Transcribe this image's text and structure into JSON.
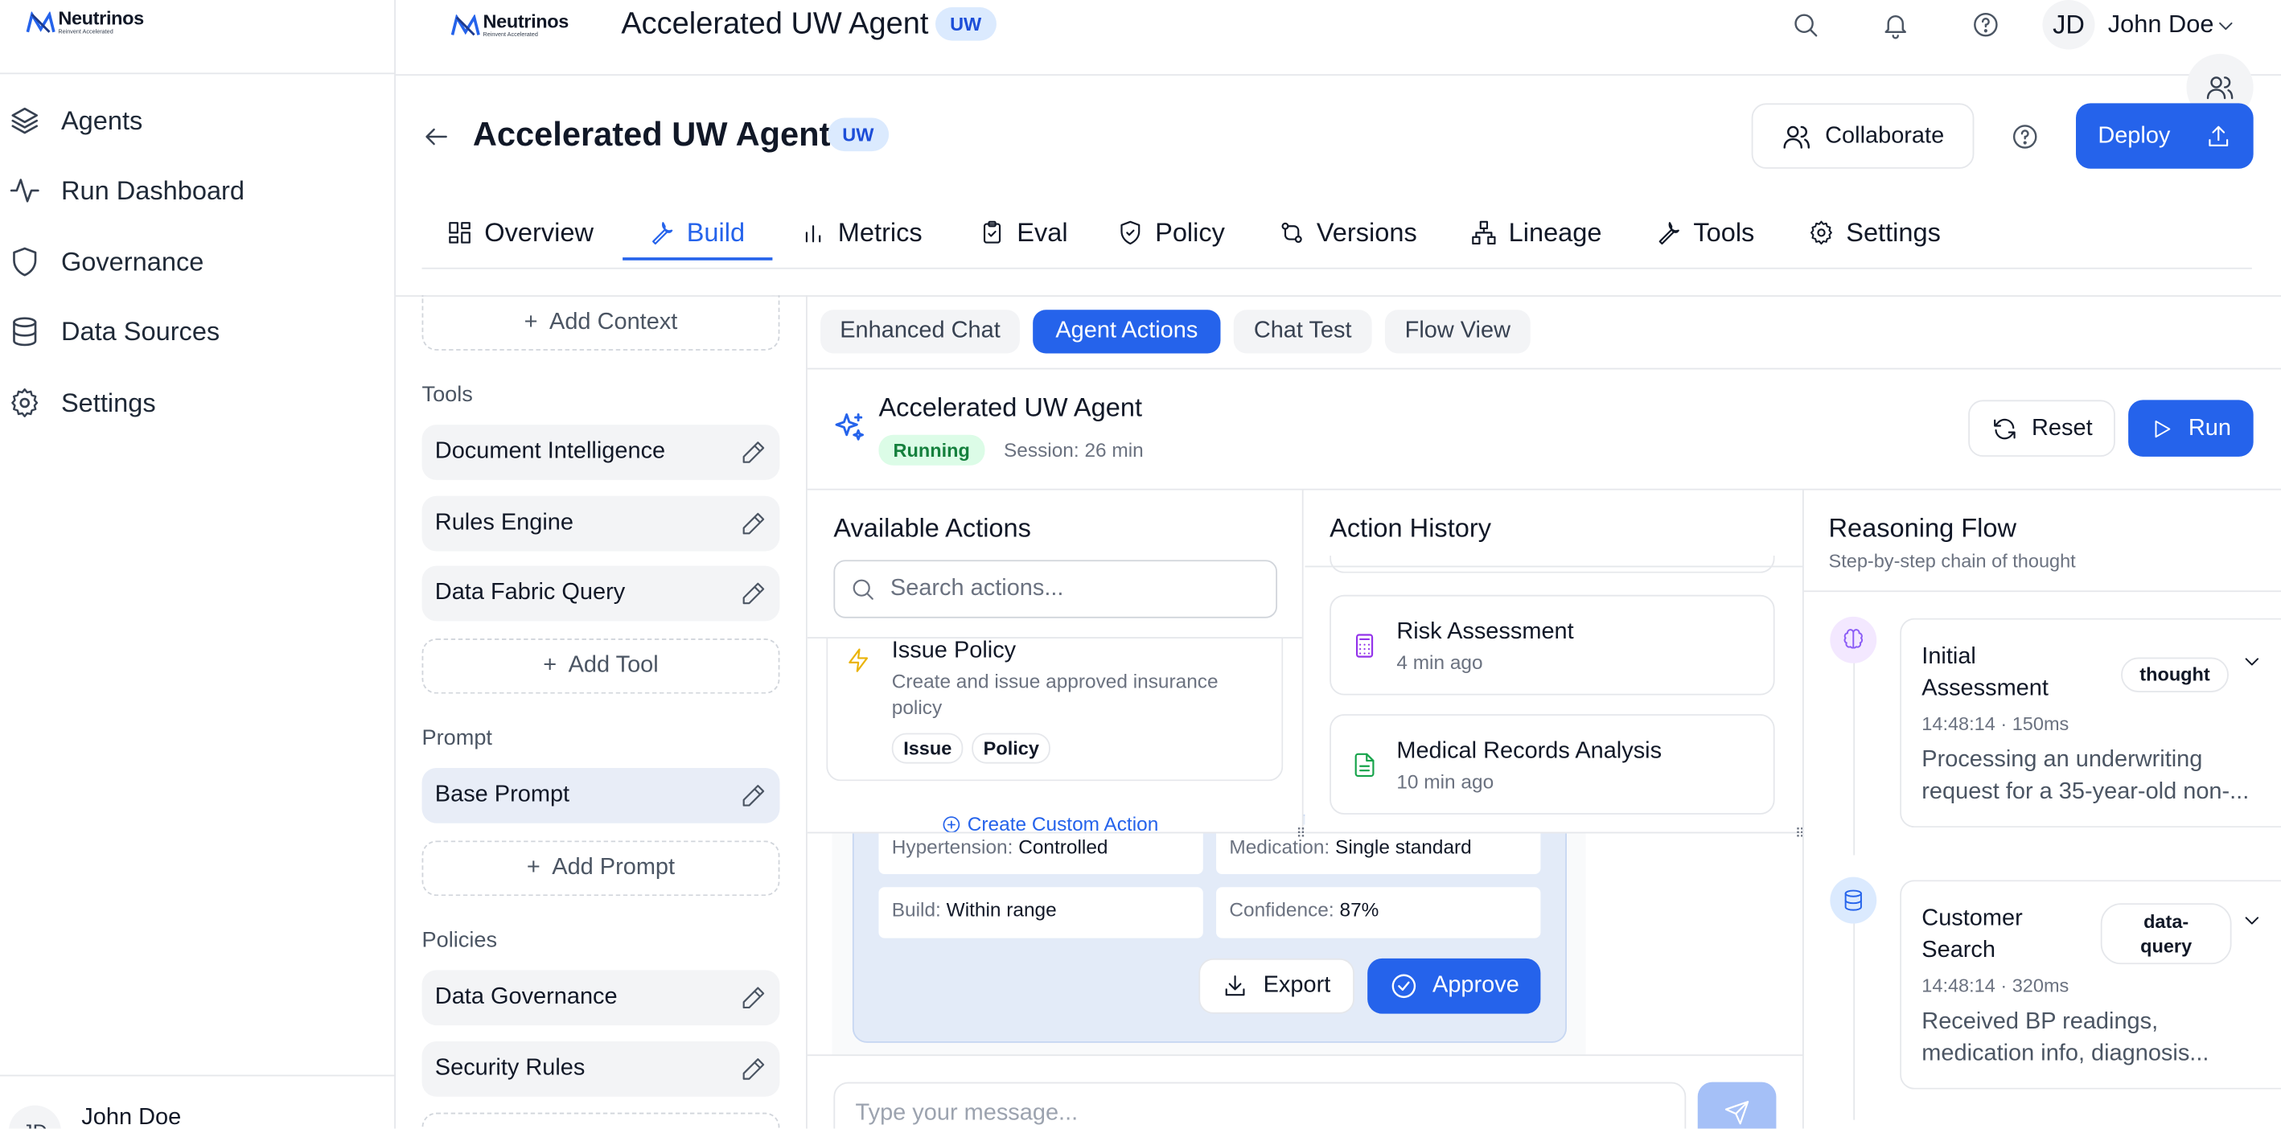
{
  "brand": {
    "name": "Neutrinos",
    "tagline": "Reinvent Accelerated"
  },
  "sidebar": {
    "items": [
      {
        "label": "Agents",
        "icon": "layers-icon"
      },
      {
        "label": "Run Dashboard",
        "icon": "activity-icon"
      },
      {
        "label": "Governance",
        "icon": "shield-icon"
      },
      {
        "label": "Data Sources",
        "icon": "database-icon"
      },
      {
        "label": "Settings",
        "icon": "gear-icon"
      }
    ],
    "user": {
      "initials": "JD",
      "name": "John Doe"
    }
  },
  "header": {
    "title": "Accelerated UW Agent",
    "badge": "UW",
    "user_initials": "JD",
    "user_name": "John Doe"
  },
  "agent": {
    "title": "Accelerated UW Agent",
    "badge": "UW",
    "collaborate_label": "Collaborate",
    "deploy_label": "Deploy"
  },
  "tabs": [
    {
      "label": "Overview",
      "icon": "grid-icon"
    },
    {
      "label": "Build",
      "icon": "wrench-icon",
      "active": true
    },
    {
      "label": "Metrics",
      "icon": "bar-chart-icon"
    },
    {
      "label": "Eval",
      "icon": "clipboard-check-icon"
    },
    {
      "label": "Policy",
      "icon": "shield-check-icon"
    },
    {
      "label": "Versions",
      "icon": "git-compare-icon"
    },
    {
      "label": "Lineage",
      "icon": "network-icon"
    },
    {
      "label": "Tools",
      "icon": "wrench-icon"
    },
    {
      "label": "Settings",
      "icon": "gear-icon"
    }
  ],
  "config": {
    "add_context": "Add Context",
    "tools_heading": "Tools",
    "tools": [
      "Document Intelligence",
      "Rules Engine",
      "Data Fabric Query"
    ],
    "add_tool": "Add Tool",
    "prompt_heading": "Prompt",
    "prompts": [
      "Base Prompt"
    ],
    "add_prompt": "Add Prompt",
    "policies_heading": "Policies",
    "policies": [
      "Data Governance",
      "Security Rules"
    ]
  },
  "subtabs": [
    "Enhanced Chat",
    "Agent Actions",
    "Chat Test",
    "Flow View"
  ],
  "active_subtab": "Agent Actions",
  "session": {
    "agent_name": "Accelerated UW Agent",
    "status": "Running",
    "session_label": "Session: 26 min",
    "reset_label": "Reset",
    "run_label": "Run"
  },
  "available_actions": {
    "heading": "Available Actions",
    "search_placeholder": "Search actions...",
    "action": {
      "title": "Issue Policy",
      "description": "Create and issue approved insurance policy",
      "tags": [
        "Issue",
        "Policy"
      ]
    },
    "create_label": "Create Custom Action"
  },
  "action_history": {
    "heading": "Action History",
    "items": [
      {
        "title": "Risk Assessment",
        "time": "4 min ago",
        "icon": "calculator-icon"
      },
      {
        "title": "Medical Records Analysis",
        "time": "10 min ago",
        "icon": "file-text-icon"
      }
    ]
  },
  "result_card": {
    "fields": [
      {
        "key": "Hypertension:",
        "value": "Controlled"
      },
      {
        "key": "Medication:",
        "value": "Single standard"
      },
      {
        "key": "Build:",
        "value": "Within range"
      },
      {
        "key": "Confidence:",
        "value": "87%"
      }
    ],
    "export_label": "Export",
    "approve_label": "Approve"
  },
  "message_input": {
    "placeholder": "Type your message..."
  },
  "reasoning": {
    "heading": "Reasoning Flow",
    "subheading": "Step-by-step chain of thought",
    "steps": [
      {
        "title_line1": "Initial",
        "title_line2": "Assessment",
        "tag": "thought",
        "meta": "14:48:14 · 150ms",
        "text_line1": "Processing an underwriting",
        "text_line2": "request for a 35-year-old non-...",
        "icon": "brain-icon",
        "color": "#8b5cf6"
      },
      {
        "title_line1": "Customer",
        "title_line2": "Search",
        "tag_line1": "data-",
        "tag_line2": "query",
        "meta": "14:48:14 · 320ms",
        "text_line1": "Received BP readings,",
        "text_line2": "medication info, diagnosis...",
        "icon": "database-icon",
        "color": "#2563eb"
      }
    ]
  },
  "colors": {
    "accent": "#2563eb",
    "running_bg": "#dcfce7",
    "running_text": "#15803d"
  }
}
